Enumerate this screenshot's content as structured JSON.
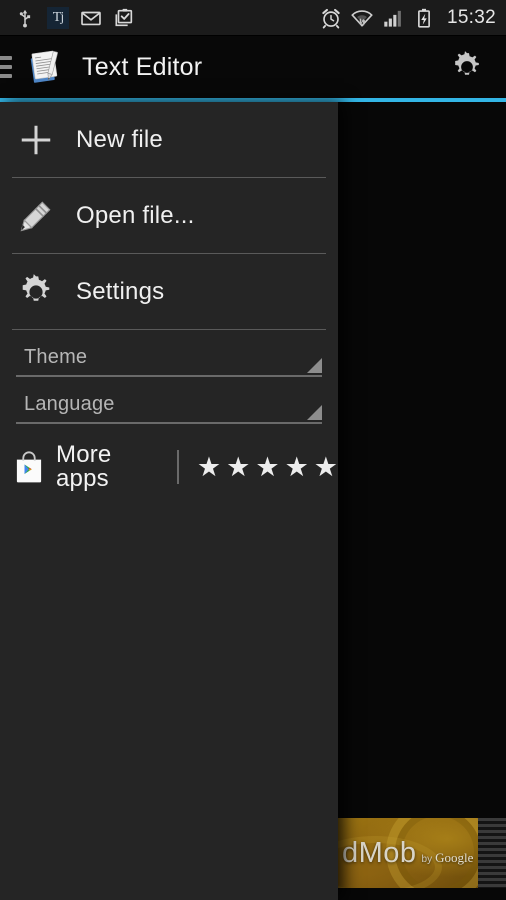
{
  "status_bar": {
    "left_icons": [
      {
        "name": "usb-icon",
        "label": "USB connected"
      },
      {
        "name": "tj-app-icon",
        "label": "Tj"
      },
      {
        "name": "mail-icon",
        "label": "New email"
      },
      {
        "name": "clipboard-check-icon",
        "label": "Task complete"
      }
    ],
    "right_icons": [
      {
        "name": "alarm-clock-icon",
        "label": "Alarm set"
      },
      {
        "name": "wifi-icon",
        "label": "Wi-Fi connected"
      },
      {
        "name": "signal-bars-icon",
        "label": "Signal strength"
      },
      {
        "name": "battery-charging-icon",
        "label": "Battery charging"
      }
    ],
    "time": "15:32"
  },
  "action_bar": {
    "drawer_indicator": "hamburger-icon",
    "app_icon": "text-editor-document-pen-icon",
    "title": "Text Editor",
    "settings_icon": "gear-icon"
  },
  "accent_color": "#33b5e5",
  "drawer": {
    "items": [
      {
        "icon": "plus-icon",
        "label": "New file"
      },
      {
        "icon": "pencil-icon",
        "label": "Open file..."
      },
      {
        "icon": "gear-icon",
        "label": "Settings"
      }
    ],
    "spinners": [
      {
        "label": "Theme",
        "arrow": "dropdown-triangle-icon"
      },
      {
        "label": "Language",
        "arrow": "dropdown-triangle-icon"
      }
    ],
    "more_apps": {
      "icon": "google-play-store-icon",
      "label": "More apps",
      "stars": [
        "★",
        "★",
        "★",
        "★",
        "★"
      ],
      "rating": 5
    }
  },
  "ad": {
    "brand": "dMob",
    "by": "by",
    "provider": "Google"
  },
  "colors": {
    "drawer_background": "#252525",
    "content_background": "#070707",
    "status_bar_background": "#1b1b1b",
    "action_bar_background": "#080808",
    "divider": "#5a5a5a",
    "primary_text": "#f0f0f0",
    "secondary_text": "#b6b6b6"
  }
}
